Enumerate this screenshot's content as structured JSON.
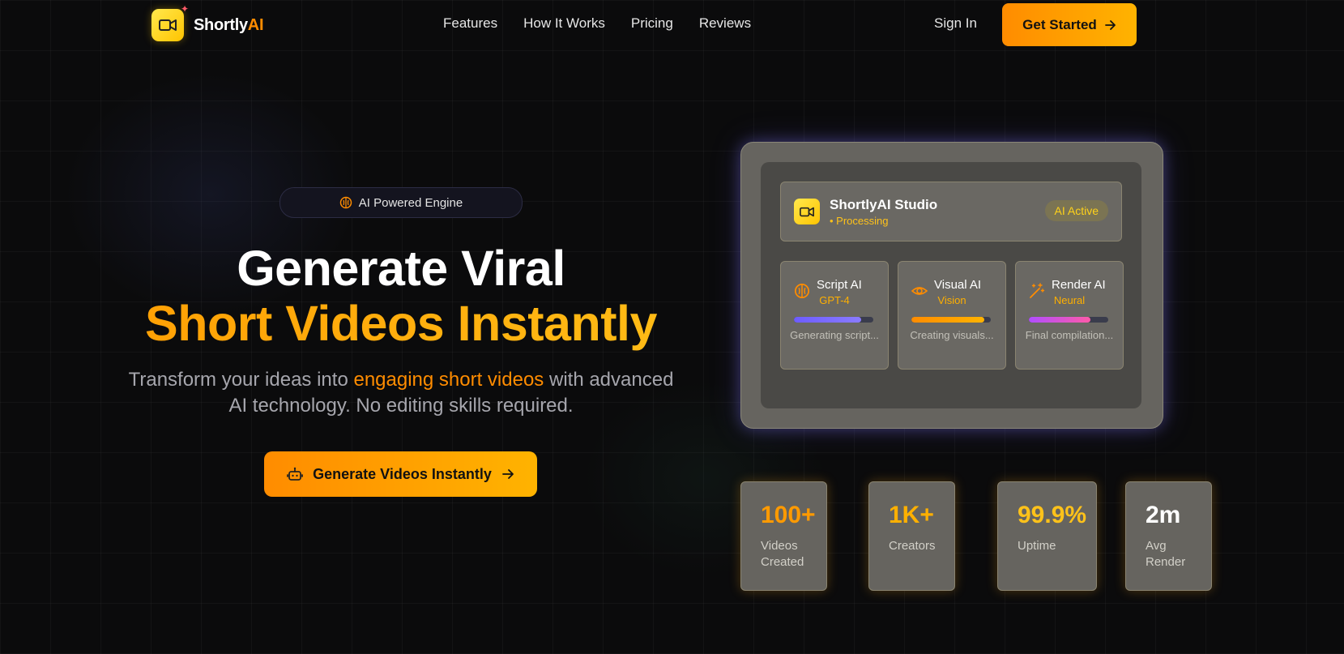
{
  "brand": {
    "name_main": "Shortly",
    "name_accent": "AI"
  },
  "nav": {
    "links": [
      "Features",
      "How It Works",
      "Pricing",
      "Reviews"
    ],
    "sign_in": "Sign In",
    "get_started": "Get Started"
  },
  "hero": {
    "badge": "AI Powered Engine",
    "title_line1": "Generate Viral",
    "title_line2": "Short Videos Instantly",
    "subtitle_pre": "Transform your ideas into ",
    "subtitle_highlight": "engaging short videos",
    "subtitle_post": " with advanced AI technology. No editing skills required.",
    "cta": "Generate Videos Instantly"
  },
  "studio": {
    "title": "ShortlyAI Studio",
    "status": "• Processing",
    "badge": "AI Active",
    "cards": [
      {
        "title": "Script AI",
        "model": "GPT-4",
        "desc": "Generating script...",
        "progress": 0.85,
        "icon": "brain-icon",
        "color": "#6d5cff"
      },
      {
        "title": "Visual AI",
        "model": "Vision",
        "desc": "Creating visuals...",
        "progress": 0.92,
        "icon": "eye-icon",
        "color": "#ff8c00"
      },
      {
        "title": "Render AI",
        "model": "Neural",
        "desc": "Final compilation...",
        "progress": 0.78,
        "icon": "wand-icon",
        "color": "#b04dff"
      }
    ]
  },
  "stats": [
    {
      "value": "100+",
      "label": "Videos Created",
      "color": "#ff9a00"
    },
    {
      "value": "1K+",
      "label": "Creators",
      "color": "#ffb000"
    },
    {
      "value": "99.9%",
      "label": "Uptime",
      "color": "#ffc21a"
    },
    {
      "value": "2m",
      "label": "Avg Render",
      "color": "#ffffff"
    }
  ],
  "colors": {
    "accent": "#ff8c00",
    "accent_light": "#ffc21a",
    "background": "#0b0b0c"
  }
}
